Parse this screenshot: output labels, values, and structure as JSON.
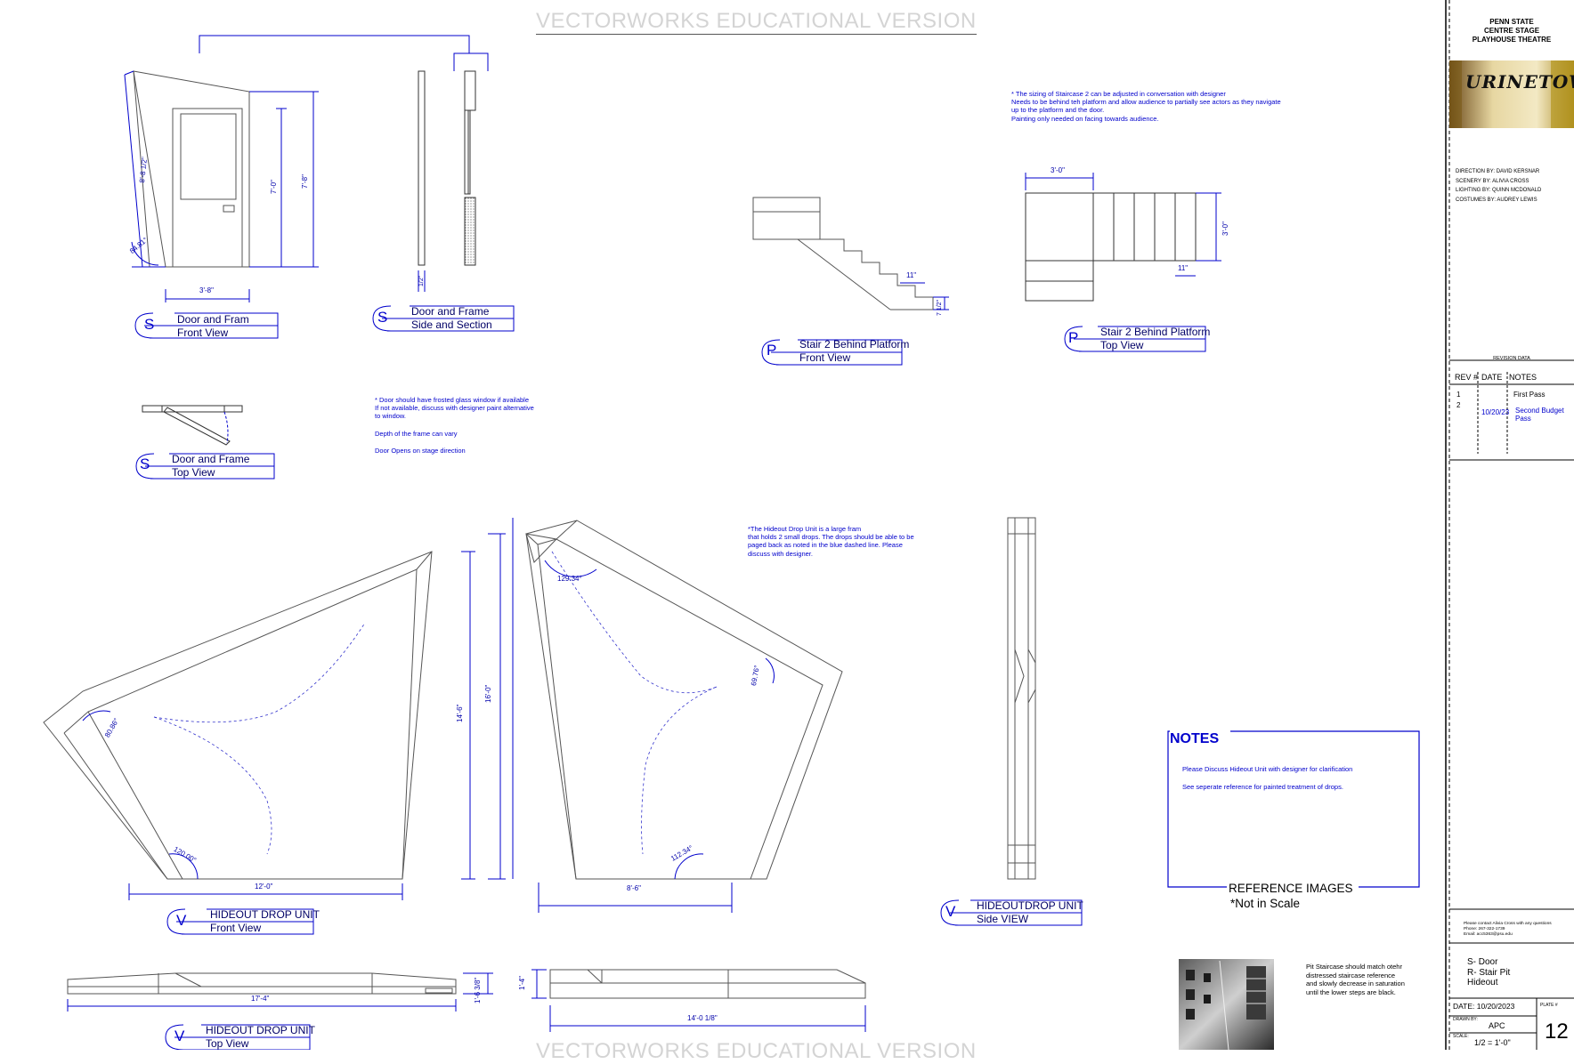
{
  "watermark": "VECTORWORKS EDUCATIONAL VERSION",
  "titleblock": {
    "org_line1": "PENN STATE",
    "org_line2": "CENTRE STAGE",
    "org_line3": "PLAYHOUSE THEATRE",
    "logo_text": "URINETOWN",
    "credits": [
      {
        "role": "DIRECTION BY:",
        "name": "DAVID KERSNAR"
      },
      {
        "role": "SCENERY BY:",
        "name": "ALIVIA CROSS"
      },
      {
        "role": "LIGHTING BY:",
        "name": "QUINN MCDONALD"
      },
      {
        "role": "COSTUMES BY:",
        "name": "AUDREY LEWIS"
      }
    ],
    "revision_title": "REVISION DATA",
    "rev_headers": {
      "rev": "REV #",
      "date": "DATE",
      "notes": "NOTES"
    },
    "revisions": [
      {
        "rev": "1",
        "date": "",
        "notes": "First Pass"
      },
      {
        "rev": "2",
        "date": "10/20/23",
        "notes": "Second Budget Pass"
      }
    ],
    "contact": {
      "line1": "Please contact Alivia Cross with any questions",
      "line2": "Phone: 267-322-1739",
      "line3": "Email: acc5363@psu.edu"
    },
    "sheet_contents": [
      "S- Door",
      "R- Stair Pit",
      "Hideout"
    ],
    "date": "DATE: 10/20/2023",
    "drawn_by_label": "DRAWN BY:",
    "drawn_by": "APC",
    "scale_label": "SCALE:",
    "scale": "1/2 = 1'-0\"",
    "plate_label": "PLATE #",
    "plate_number": "12"
  },
  "views": {
    "door_front": {
      "letter": "S",
      "line1": "Door and Fram",
      "line2": "Front View"
    },
    "door_side": {
      "letter": "S",
      "line1": "Door and Frame",
      "line2": "Side and Section"
    },
    "door_top": {
      "letter": "S",
      "line1": "Door and Frame",
      "line2": "Top View"
    },
    "stair_front": {
      "letter": "P",
      "line1": "Stair 2 Behind Platform",
      "line2": "Front View"
    },
    "stair_top": {
      "letter": "P",
      "line1": "Stair 2 Behind Platform",
      "line2": "Top View"
    },
    "hideout_front": {
      "letter": "V",
      "line1": "HIDEOUT DROP UNIT",
      "line2": "Front View"
    },
    "hideout_side": {
      "letter": "V",
      "line1": "HIDEOUTDROP UNIT",
      "line2": "Side VIEW"
    },
    "hideout_top": {
      "letter": "V",
      "line1": "HIDEOUT DROP UNIT",
      "line2": "Top View"
    }
  },
  "notes": {
    "staircase": [
      "* The sizing of Staircase 2 can be adjusted in conversation with designer",
      "Needs to be behind teh platform and allow audience to partially see actors as they navigate",
      "up to the platform and the door.",
      "Painting only needed on facing towards audience."
    ],
    "door": [
      "* Door should have frosted glass window if available",
      "If not available, discuss with designer paint alternative",
      "to window."
    ],
    "door_depth": "Depth of the frame can vary",
    "door_opens": "Door Opens on stage direction",
    "hideout": [
      "*The Hideout Drop Unit is a large fram",
      "that holds 2 small drops. The drops should be able to be",
      "paged back as noted in the blue dashed line. Please",
      "discuss with designer."
    ],
    "notes_box_title": "NOTES",
    "notes_box_lines": [
      "Please Discuss Hideout Unit with designer for clarification",
      "See seperate reference for painted treatment of drops."
    ],
    "reference_title": "REFERENCE IMAGES",
    "reference_sub": "*Not in Scale",
    "pit_staircase": [
      "Pit Staircase should match otehr",
      "distressed staircase reference",
      "and slowly decrease in saturation",
      "until the lower steps are black."
    ]
  },
  "dimensions": {
    "door_width": "3'-8\"",
    "door_height": "7'-0\"",
    "frame_height": "7'-8\"",
    "slant_length": "8'-8 1/2\"",
    "slant_angle": "84.81°",
    "side_depth": "1/2\"",
    "stair_width": "3'-0\"",
    "stair_depth": "3'-0\"",
    "tread": "11\"",
    "tread_top": "11\"",
    "riser": "7 1/2\"",
    "hideout_front_width": "12'-0\"",
    "hideout_front_h1": "14'-6\"",
    "hideout_front_h2": "16'-0\"",
    "angle_a": "80.86°",
    "angle_b": "120.00°",
    "back_width": "8'-6\"",
    "angle_c": "129.34°",
    "angle_d": "112.34°",
    "angle_e": "69.76°",
    "top_width": "17'-4\"",
    "top_depth": "1'-6 3/8\"",
    "top2_width": "14'-0 1/8\"",
    "top2_depth": "1'-4\""
  }
}
